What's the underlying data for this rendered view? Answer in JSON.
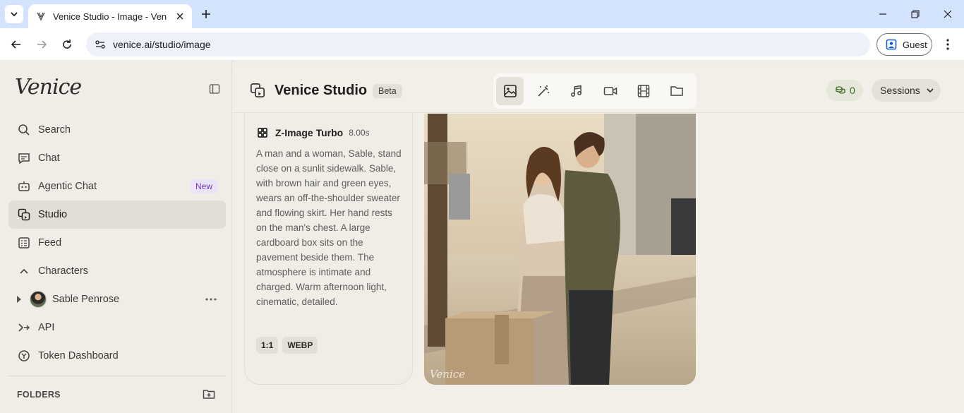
{
  "browser": {
    "tab_title": "Venice Studio - Image - Venice.ai",
    "url": "venice.ai/studio/image",
    "profile_label": "Guest"
  },
  "sidebar": {
    "logo": "Venice",
    "items": [
      {
        "label": "Search",
        "icon": "search-icon"
      },
      {
        "label": "Chat",
        "icon": "chat-icon"
      },
      {
        "label": "Agentic Chat",
        "icon": "robot-icon",
        "badge": "New"
      },
      {
        "label": "Studio",
        "icon": "studio-icon",
        "active": true
      },
      {
        "label": "Feed",
        "icon": "feed-icon"
      },
      {
        "label": "Characters",
        "icon": "chevron-up-icon"
      }
    ],
    "character": {
      "name": "Sable Penrose"
    },
    "bottom_items": [
      {
        "label": "API",
        "icon": "api-icon"
      },
      {
        "label": "Token Dashboard",
        "icon": "token-icon"
      }
    ],
    "folders_label": "FOLDERS"
  },
  "header": {
    "title": "Venice Studio",
    "badge": "Beta",
    "modes": [
      "image-icon",
      "magic-wand-icon",
      "music-icon",
      "video-icon",
      "film-icon",
      "folder-icon"
    ],
    "active_mode": "image-icon",
    "credits": "0",
    "sessions_label": "Sessions"
  },
  "result": {
    "model": "Z-Image Turbo",
    "duration": "8.00s",
    "prompt": "A man and a woman, Sable, stand close on a sunlit sidewalk. Sable, with brown hair and green eyes, wears an off-the-shoulder sweater and flowing skirt. Her hand rests on the man's chest. A large cardboard box sits on the pavement beside them. The atmosphere is intimate and charged. Warm afternoon light, cinematic, detailed.",
    "tags": [
      "1:1",
      "WEBP"
    ],
    "image_watermark": "Venice"
  },
  "colors": {
    "accent_purple": "#6b3fb0",
    "credits_green": "#3d6b23",
    "background": "#f0ede6"
  }
}
